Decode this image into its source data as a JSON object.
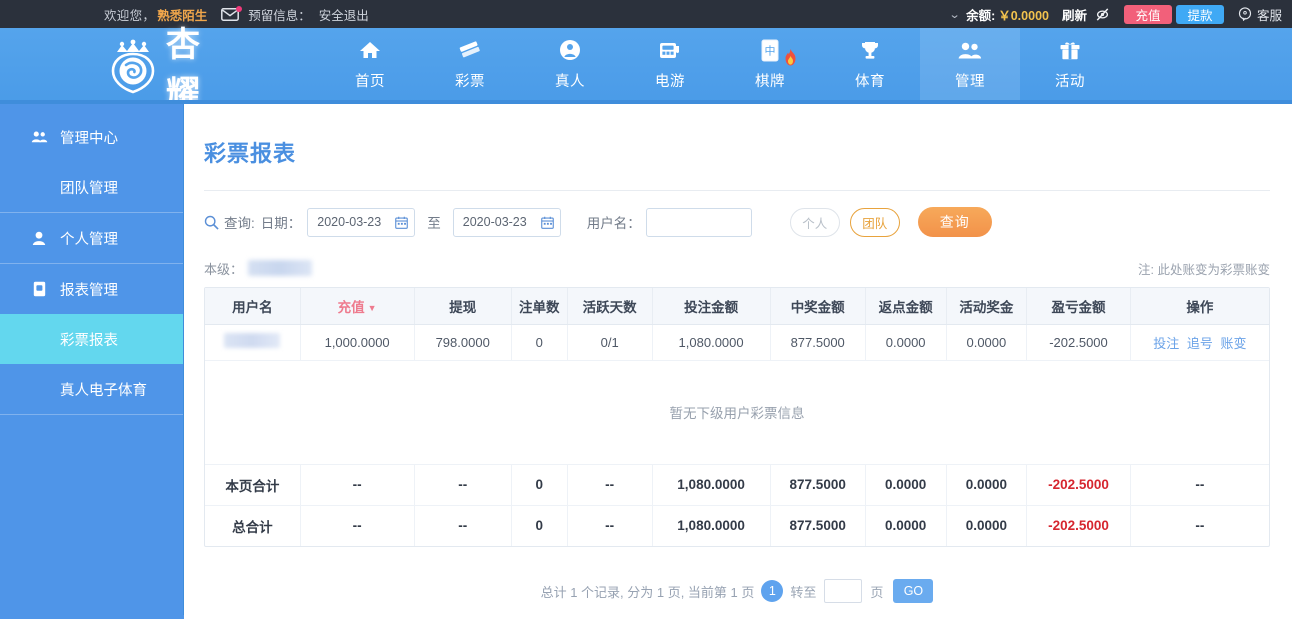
{
  "topbar": {
    "welcome": "欢迎您，",
    "username": "熟悉陌生",
    "mail_icon": "mail-icon",
    "reserved_info": "预留信息：",
    "logout": "安全退出",
    "chevron": "⌄",
    "balance_label": "余额:",
    "balance_value": "￥0.0000",
    "refresh": "刷新",
    "eye_icon": "eye-off-icon",
    "recharge": "充值",
    "withdraw": "提款",
    "service": "客服",
    "colors": {
      "bg": "#2b313c",
      "username": "#f0a64b",
      "balance": "#f2c34e",
      "recharge_bg": "#f2607a",
      "withdraw_bg": "#3fa9f5"
    }
  },
  "brand": {
    "logo_icon": "crown-lion-logo",
    "name": "杏耀"
  },
  "nav": {
    "items": [
      {
        "label": "首页",
        "icon": "home-icon",
        "active": false
      },
      {
        "label": "彩票",
        "icon": "ticket-icon",
        "active": false
      },
      {
        "label": "真人",
        "icon": "person-circle-icon",
        "active": false
      },
      {
        "label": "电游",
        "icon": "slot-machine-icon",
        "active": false
      },
      {
        "label": "棋牌",
        "icon": "mahjong-tile-icon",
        "active": false,
        "badge": "fire-icon"
      },
      {
        "label": "体育",
        "icon": "trophy-icon",
        "active": false
      },
      {
        "label": "管理",
        "icon": "users-icon",
        "active": true
      },
      {
        "label": "活动",
        "icon": "gift-icon",
        "active": false
      }
    ]
  },
  "sidebar": {
    "groups": [
      {
        "parent": {
          "label": "管理中心",
          "icon": "users-icon"
        },
        "children": [
          {
            "label": "团队管理",
            "active": false
          }
        ]
      },
      {
        "parent": {
          "label": "个人管理",
          "icon": "user-icon"
        },
        "children": []
      },
      {
        "parent": {
          "label": "报表管理",
          "icon": "report-icon"
        },
        "children": [
          {
            "label": "彩票报表",
            "active": true
          },
          {
            "label": "真人电子体育",
            "active": false
          }
        ]
      }
    ]
  },
  "main": {
    "title": "彩票报表",
    "filter": {
      "search_icon": "search-icon",
      "query_label": "查询:",
      "date_label": "日期：",
      "date_from": "2020-03-23",
      "date_to": "2020-03-23",
      "to_label": "至",
      "calendar_icon": "calendar-icon",
      "username_label": "用户名：",
      "username_value": "",
      "username_placeholder": "",
      "toggle_personal": "个人",
      "toggle_team": "团队",
      "toggle_active": "团队",
      "query_button": "查询"
    },
    "level": {
      "label": "本级：",
      "value_masked": "",
      "note": "注: 此处账变为彩票账变"
    },
    "table": {
      "columns": [
        {
          "label": "用户名",
          "sorted": false
        },
        {
          "label": "充值",
          "sorted": true,
          "caret": "▼"
        },
        {
          "label": "提现",
          "sorted": false
        },
        {
          "label": "注单数",
          "sorted": false
        },
        {
          "label": "活跃天数",
          "sorted": false
        },
        {
          "label": "投注金额",
          "sorted": false
        },
        {
          "label": "中奖金额",
          "sorted": false
        },
        {
          "label": "返点金额",
          "sorted": false
        },
        {
          "label": "活动奖金",
          "sorted": false
        },
        {
          "label": "盈亏金额",
          "sorted": false
        },
        {
          "label": "操作",
          "sorted": false
        }
      ],
      "rows": [
        {
          "username_masked": "",
          "recharge": "1,000.0000",
          "withdraw": "798.0000",
          "bet_count": "0",
          "active_days": "0/1",
          "bet_amount": "1,080.0000",
          "win_amount": "877.5000",
          "rebate": "0.0000",
          "bonus": "0.0000",
          "profit": "-202.5000",
          "ops": [
            "投注",
            "追号",
            "账变"
          ]
        }
      ],
      "empty_message": "暂无下级用户彩票信息",
      "summaries": [
        {
          "label": "本页合计",
          "recharge": "--",
          "withdraw": "--",
          "bet_count": "0",
          "active_days": "--",
          "bet_amount": "1,080.0000",
          "win_amount": "877.5000",
          "rebate": "0.0000",
          "bonus": "0.0000",
          "profit": "-202.5000",
          "ops": "--"
        },
        {
          "label": "总合计",
          "recharge": "--",
          "withdraw": "--",
          "bet_count": "0",
          "active_days": "--",
          "bet_amount": "1,080.0000",
          "win_amount": "877.5000",
          "rebate": "0.0000",
          "bonus": "0.0000",
          "profit": "-202.5000",
          "ops": "--"
        }
      ]
    },
    "pagination": {
      "summary": "总计 1 个记录, 分为 1 页, 当前第 1 页",
      "current_page": "1",
      "jump_label": "转至",
      "jump_value": "",
      "unit": "页",
      "go": "GO"
    }
  }
}
